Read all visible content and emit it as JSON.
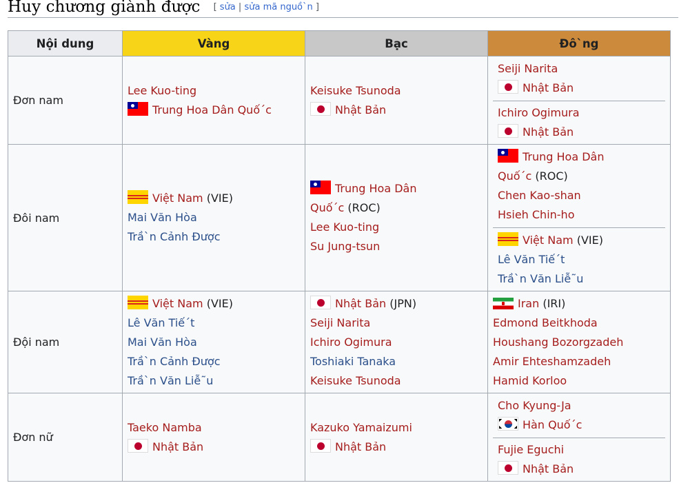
{
  "section": {
    "title": "Huy chương giành được",
    "edit_open": "[",
    "edit": "sửa",
    "separator": "|",
    "edit_source": "sửa mã nguồ`n",
    "edit_close": "]"
  },
  "table": {
    "headers": {
      "event": "Nội dung",
      "gold": "Vàng",
      "silver": "Bạc",
      "bronze": "Đô`ng"
    },
    "header_colors": {
      "event": "#eaecf0",
      "gold": "#f7d417",
      "silver": "#c8c8c8",
      "bronze": "#cc8a3c"
    },
    "rows": [
      {
        "event": "Đơn nam",
        "gold": {
          "player": "Lee Kuo-ting",
          "country": "Trung Hoa Dân Quố´c",
          "flag": "flag-taiwan-icon"
        },
        "silver": {
          "player": "Keisuke Tsunoda",
          "country": "Nhật Bản",
          "flag": "flag-japan-icon"
        },
        "bronze": [
          {
            "player": "Seiji Narita",
            "country": "Nhật Bản",
            "flag": "flag-japan-icon"
          },
          {
            "player": "Ichiro Ogimura",
            "country": "Nhật Bản",
            "flag": "flag-japan-icon"
          }
        ]
      },
      {
        "event": "Đôi nam",
        "gold": {
          "country": "Việt Nam",
          "code": "(VIE)",
          "flag": "flag-south-vietnam-icon",
          "players": [
            "Mai Văn Hòa",
            "Trầ`n Cảnh Được"
          ]
        },
        "silver": {
          "country_line1": "Trung Hoa Dân",
          "country_line2": "Quố´c",
          "code": "(ROC)",
          "flag": "flag-taiwan-icon",
          "players": [
            "Lee Kuo-ting",
            "Su Jung-tsun"
          ]
        },
        "bronze": [
          {
            "country_line1": "Trung Hoa Dân",
            "country_line2": "Quố´c",
            "code": "(ROC)",
            "flag": "flag-taiwan-icon",
            "players": [
              "Chen Kao-shan",
              "Hsieh Chin-ho"
            ]
          },
          {
            "country": "Việt Nam",
            "code": "(VIE)",
            "flag": "flag-south-vietnam-icon",
            "players": [
              "Lê Văn Tiế´t",
              "Trầ`n Văn Liễ˜u"
            ]
          }
        ]
      },
      {
        "event": "Đội nam",
        "gold": {
          "country": "Việt Nam",
          "code": "(VIE)",
          "flag": "flag-south-vietnam-icon",
          "players": [
            "Lê Văn Tiế´t",
            "Mai Văn Hòa",
            "Trầ`n Cảnh Được",
            "Trầ`n Văn Liễ˜u"
          ]
        },
        "silver": {
          "country": "Nhật Bản",
          "code": "(JPN)",
          "flag": "flag-japan-icon",
          "players": [
            "Seiji Narita",
            "Ichiro Ogimura",
            "Toshiaki Tanaka",
            "Keisuke Tsunoda"
          ]
        },
        "bronze": {
          "country": "Iran",
          "code": "(IRI)",
          "flag": "flag-iran-icon",
          "players": [
            "Edmond Beitkhoda",
            "Houshang Bozorgzadeh",
            "Amir Ehteshamzadeh",
            "Hamid Korloo"
          ]
        }
      },
      {
        "event": "Đơn nữ",
        "gold": {
          "player": "Taeko Namba",
          "country": "Nhật Bản",
          "flag": "flag-japan-icon"
        },
        "silver": {
          "player": "Kazuko Yamaizumi",
          "country": "Nhật Bản",
          "flag": "flag-japan-icon"
        },
        "bronze": [
          {
            "player": "Cho Kyung-Ja",
            "country": "Hàn Quố´c",
            "flag": "flag-south-korea-icon"
          },
          {
            "player": "Fujie Eguchi",
            "country": "Nhật Bản",
            "flag": "flag-japan-icon"
          }
        ]
      }
    ]
  },
  "colors": {
    "link_red": "#a51d1d",
    "link_blue": "#2b4f8a",
    "table_bg": "#f8f9fa",
    "border": "#a2a9b1"
  }
}
